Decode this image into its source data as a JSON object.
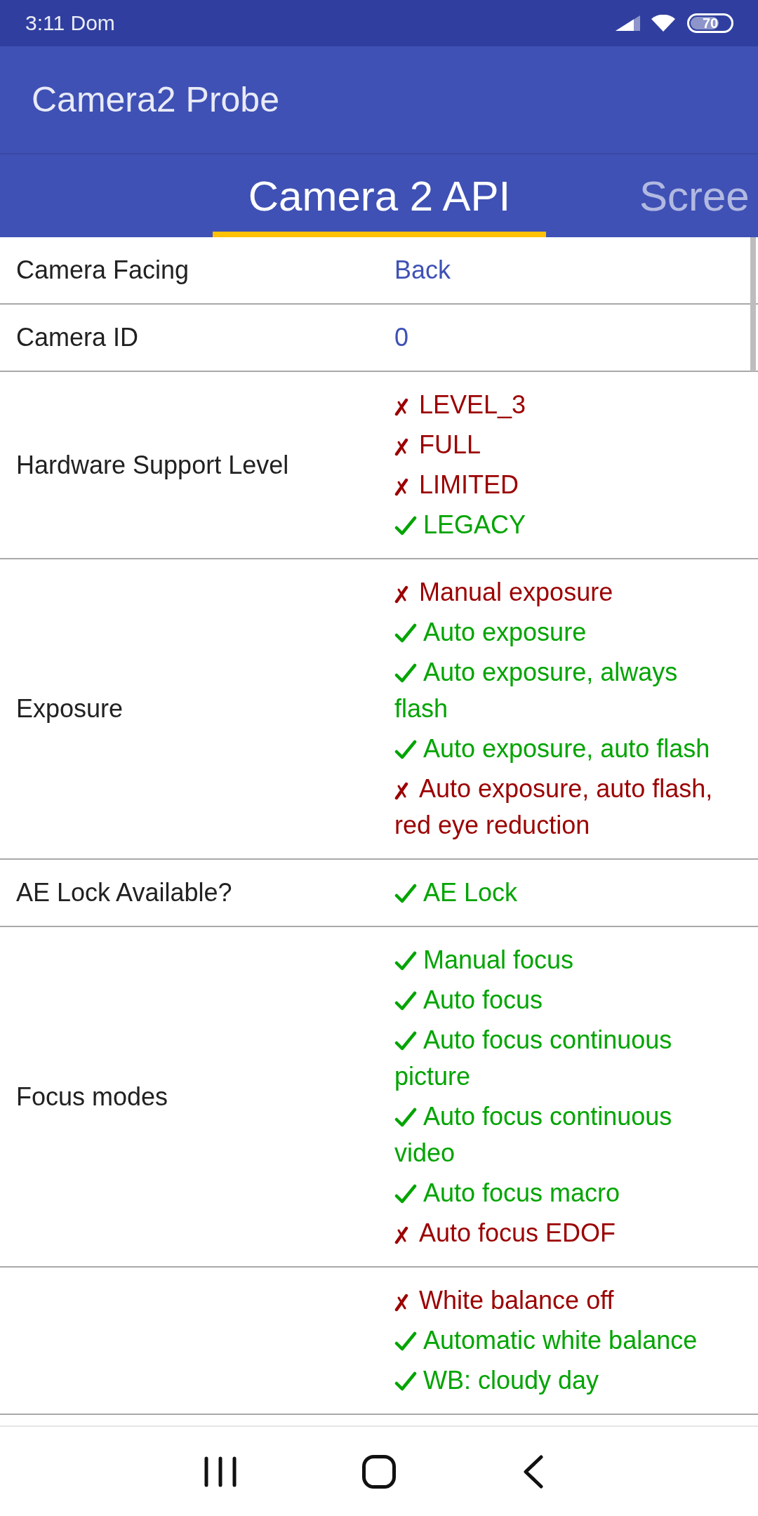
{
  "status_bar": {
    "time": "3:11 Dom",
    "battery": "70"
  },
  "app_bar": {
    "title": "Camera2 Probe"
  },
  "tabs": [
    {
      "label": "Camera 2 API",
      "selected": true
    },
    {
      "label": "Scree",
      "selected": false
    }
  ],
  "rows": [
    {
      "kind": "text",
      "label": "Camera Facing",
      "value": "Back"
    },
    {
      "kind": "text",
      "label": "Camera ID",
      "value": "0"
    },
    {
      "kind": "list",
      "label": "Hardware Support Level",
      "features": [
        {
          "text": "LEVEL_3",
          "supported": false
        },
        {
          "text": "FULL",
          "supported": false
        },
        {
          "text": "LIMITED",
          "supported": false
        },
        {
          "text": "LEGACY",
          "supported": true
        }
      ]
    },
    {
      "kind": "list",
      "label": "Exposure",
      "features": [
        {
          "text": "Manual exposure",
          "supported": false
        },
        {
          "text": "Auto exposure",
          "supported": true
        },
        {
          "text": "Auto exposure, always flash",
          "supported": true
        },
        {
          "text": "Auto exposure, auto flash",
          "supported": true
        },
        {
          "text": "Auto exposure, auto flash, red eye reduction",
          "supported": false
        }
      ]
    },
    {
      "kind": "list",
      "label": "AE Lock Available?",
      "features": [
        {
          "text": "AE Lock",
          "supported": true
        }
      ]
    },
    {
      "kind": "list",
      "label": "Focus modes",
      "features": [
        {
          "text": "Manual focus",
          "supported": true
        },
        {
          "text": "Auto focus",
          "supported": true
        },
        {
          "text": "Auto focus continuous picture",
          "supported": true
        },
        {
          "text": "Auto focus continuous video",
          "supported": true
        },
        {
          "text": "Auto focus macro",
          "supported": true
        },
        {
          "text": "Auto focus EDOF",
          "supported": false
        }
      ]
    },
    {
      "kind": "list",
      "features": [
        {
          "text": "White balance off",
          "supported": false
        },
        {
          "text": "Automatic white balance",
          "supported": true
        },
        {
          "text": "WB: cloudy day",
          "supported": true
        }
      ]
    }
  ]
}
